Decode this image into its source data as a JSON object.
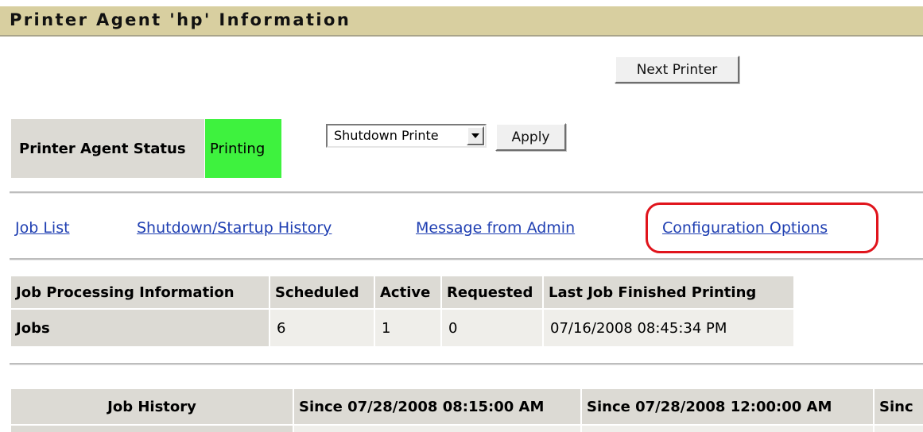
{
  "page": {
    "title": "Printer Agent 'hp' Information"
  },
  "buttons": {
    "next_printer": "Next Printer",
    "apply": "Apply"
  },
  "status": {
    "label": "Printer Agent Status",
    "value": "Printing",
    "value_color": "#3ef23e"
  },
  "action_select": {
    "selected": "Shutdown Printe"
  },
  "nav": {
    "links": [
      "Job List",
      "Shutdown/Startup History",
      "Message from Admin",
      "Configuration Options"
    ],
    "highlight_color": "#e0141c",
    "link_color": "#1f3fb2"
  },
  "job_processing": {
    "headers": [
      "Job Processing Information",
      "Scheduled",
      "Active",
      "Requested",
      "Last Job Finished Printing"
    ],
    "rows": [
      [
        "Jobs",
        "6",
        "1",
        "0",
        "07/16/2008 08:45:34 PM"
      ]
    ]
  },
  "job_history": {
    "headers": [
      "Job History",
      "Since 07/28/2008 08:15:00 AM",
      "Since 07/28/2008 12:00:00 AM",
      "Sinc"
    ]
  }
}
